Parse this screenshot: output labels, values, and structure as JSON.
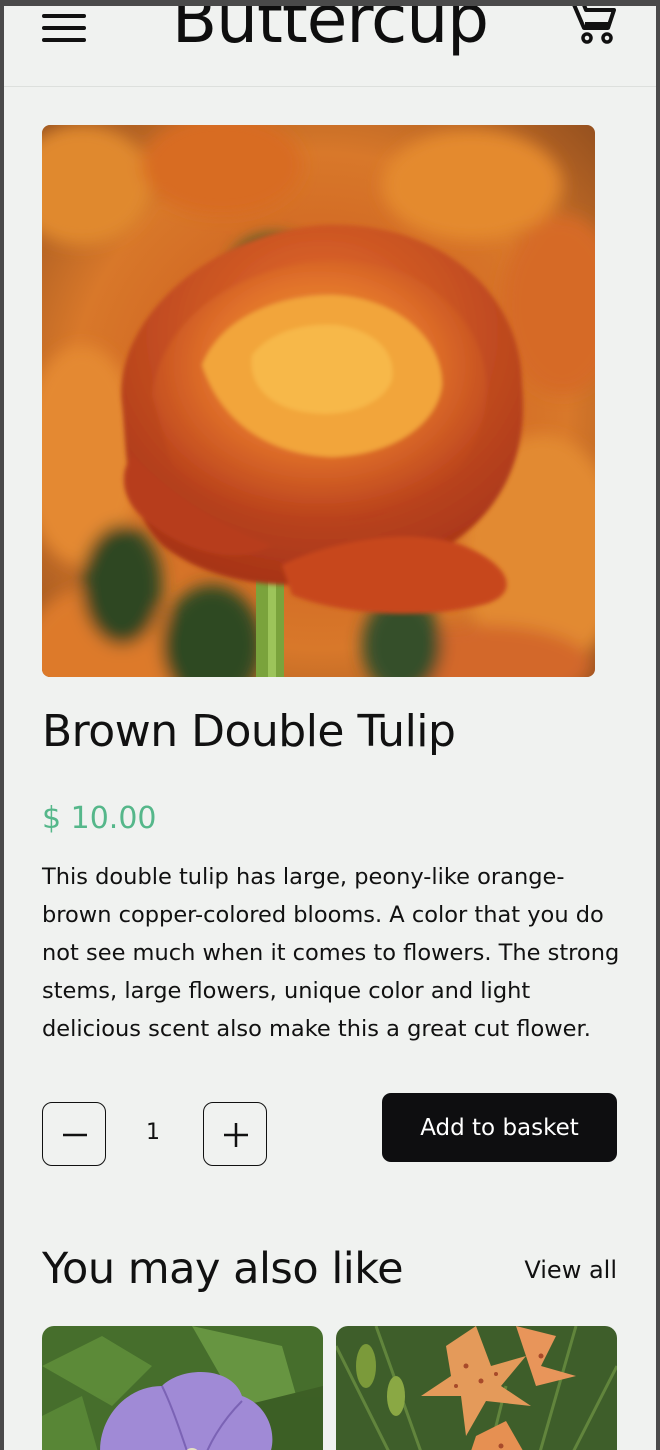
{
  "header": {
    "brand": "Buttercup",
    "menu_icon": "hamburger-menu-icon",
    "cart_icon": "shopping-cart-icon"
  },
  "product": {
    "image": "orange double tulip photo",
    "name": "Brown Double Tulip",
    "price": "$ 10.00",
    "description": "This double tulip has large, peony-like orange-brown copper-colored blooms. A color that you do not see much when it comes to flowers. The strong stems, large flowers, unique color and light delicious scent also make this a great cut flower.",
    "quantity": "1",
    "decrease_icon": "minus-icon",
    "increase_icon": "plus-icon",
    "add_label": "Add to basket"
  },
  "recommendations": {
    "title": "You may also like",
    "view_all": "View all",
    "cards": [
      {
        "image": "purple geranium photo"
      },
      {
        "image": "orange spotted lily photo"
      }
    ]
  },
  "colors": {
    "page_bg": "#f0f2f0",
    "price": "#55b78a",
    "button_bg": "#0e0e10",
    "text": "#111111"
  }
}
